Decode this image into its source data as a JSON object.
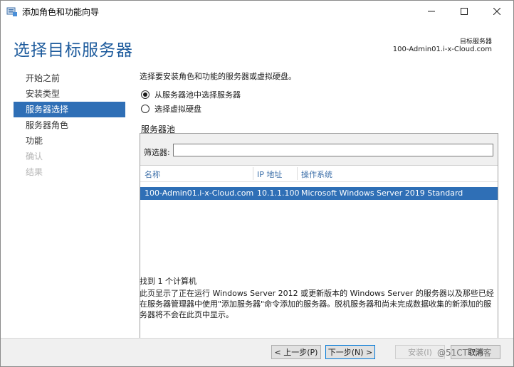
{
  "window": {
    "title": "添加角色和功能向导",
    "app_icon": "server-manager-icon"
  },
  "header": {
    "page_title": "选择目标服务器",
    "destination_label": "目标服务器",
    "destination_server": "100-Admin01.i-x-Cloud.com"
  },
  "nav": {
    "items": [
      {
        "label": "开始之前",
        "state": "normal"
      },
      {
        "label": "安装类型",
        "state": "normal"
      },
      {
        "label": "服务器选择",
        "state": "selected"
      },
      {
        "label": "服务器角色",
        "state": "normal"
      },
      {
        "label": "功能",
        "state": "normal"
      },
      {
        "label": "确认",
        "state": "disabled"
      },
      {
        "label": "结果",
        "state": "disabled"
      }
    ]
  },
  "content": {
    "intro": "选择要安装角色和功能的服务器或虚拟硬盘。",
    "options": [
      {
        "label": "从服务器池中选择服务器",
        "selected": true
      },
      {
        "label": "选择虚拟硬盘",
        "selected": false
      }
    ],
    "pool_label": "服务器池",
    "filter_label": "筛选器:",
    "filter_value": "",
    "columns": [
      "名称",
      "IP 地址",
      "操作系统"
    ],
    "rows": [
      [
        "100-Admin01.i-x-Cloud.com",
        "10.1.1.100",
        "Microsoft Windows Server 2019 Standard"
      ]
    ],
    "found_text": "找到 1 个计算机",
    "description": "此页显示了正在运行 Windows Server 2012 或更新版本的 Windows Server 的服务器以及那些已经在服务器管理器中使用\"添加服务器\"命令添加的服务器。脱机服务器和尚未完成数据收集的新添加的服务器将不会在此页中显示。"
  },
  "footer": {
    "prev": "< 上一步(P)",
    "next": "下一步(N) >",
    "install": "安装(I)",
    "cancel": "取消"
  },
  "watermark": "@51CTO博客",
  "colors": {
    "accent": "#2f6fb6",
    "title_blue": "#1c5a9c"
  }
}
